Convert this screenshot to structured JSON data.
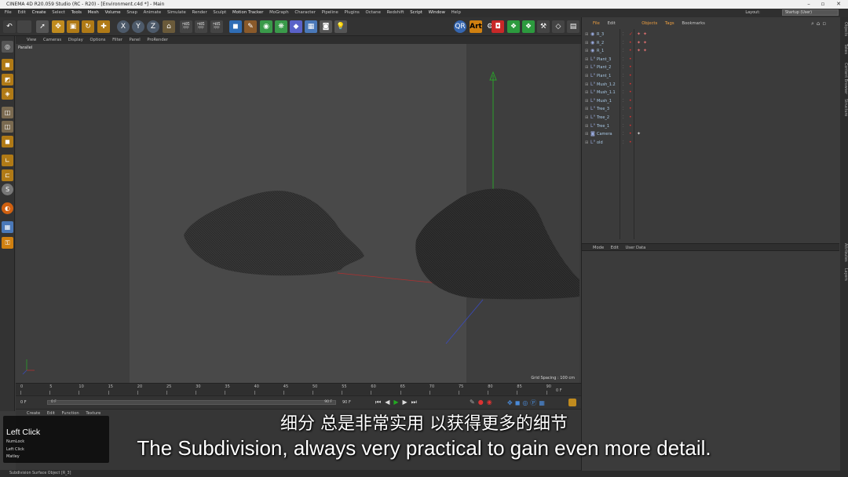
{
  "window": {
    "title": "CINEMA 4D R20.059 Studio (RC - R20) - [Environment.c4d *] - Main"
  },
  "menu": [
    "File",
    "Edit",
    "Create",
    "Select",
    "Tools",
    "Mesh",
    "Volume",
    "Snap",
    "Animate",
    "Simulate",
    "Render",
    "Sculpt",
    "Motion Tracker",
    "MoGraph",
    "Character",
    "Pipeline",
    "Plugins",
    "Octane",
    "Redshift",
    "Script",
    "Window",
    "Help"
  ],
  "layout": {
    "label": "Layout:",
    "value": "Startup (User)"
  },
  "viewport_menu": [
    "View",
    "Cameras",
    "Display",
    "Options",
    "Filter",
    "Panel",
    "ProRender"
  ],
  "viewport": {
    "projection": "Parallel",
    "grid_spacing": "Grid Spacing : 100 cm"
  },
  "timeline": {
    "ticks": [
      "0",
      "5",
      "10",
      "15",
      "20",
      "25",
      "30",
      "35",
      "40",
      "45",
      "50",
      "55",
      "60",
      "65",
      "70",
      "75",
      "80",
      "85",
      "90"
    ],
    "end_label": "0 F"
  },
  "playback": {
    "start": "0 F",
    "current": "0 F",
    "end": "90 F",
    "end2": "90 F",
    "range_end": "90 F"
  },
  "bottom_menu": [
    "Create",
    "Edit",
    "Function",
    "Texture"
  ],
  "status": "Subdivision Surface Object [R_3]",
  "objects_panel": {
    "tabs": [
      "File",
      "Edit",
      "Objects",
      "Tags",
      "Bookmarks"
    ],
    "rows": [
      {
        "name": "R_3",
        "icon": "subdiv-icon",
        "check": true
      },
      {
        "name": "R_2",
        "icon": "subdiv-icon",
        "check": false
      },
      {
        "name": "R_1",
        "icon": "subdiv-icon",
        "check": false
      },
      {
        "name": "Plant_3",
        "icon": "null-icon",
        "check": false
      },
      {
        "name": "Plant_2",
        "icon": "null-icon",
        "check": false
      },
      {
        "name": "Plant_1",
        "icon": "null-icon",
        "check": false
      },
      {
        "name": "Mush_1.2",
        "icon": "null-icon",
        "check": false
      },
      {
        "name": "Mush_1.1",
        "icon": "null-icon",
        "check": false
      },
      {
        "name": "Mush_1",
        "icon": "null-icon",
        "check": false
      },
      {
        "name": "Tree_3",
        "icon": "null-icon",
        "check": false
      },
      {
        "name": "Tree_2",
        "icon": "null-icon",
        "check": false
      },
      {
        "name": "Tree_1",
        "icon": "null-icon",
        "check": false
      },
      {
        "name": "Camera",
        "icon": "camera-icon",
        "check": false
      },
      {
        "name": "old",
        "icon": "null-icon",
        "check": false
      }
    ]
  },
  "attributes_menu": [
    "Mode",
    "Edit",
    "User Data"
  ],
  "side_tabs": [
    "Objects",
    "Takes",
    "Content Browser",
    "Structure",
    "Attributes",
    "Layers"
  ],
  "hud": {
    "title": "Left Click",
    "lines": [
      "NumLock",
      "Left Click",
      "Matley"
    ]
  },
  "subtitles": {
    "cn": "细分 总是非常实用 以获得更多的细节",
    "en": "The Subdivision, always very practical to gain even more detail."
  }
}
